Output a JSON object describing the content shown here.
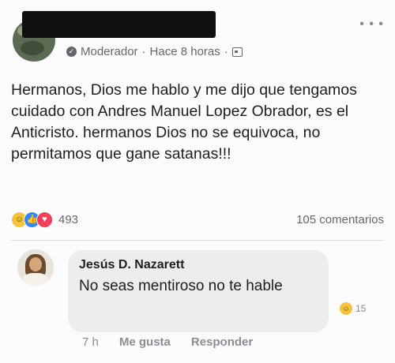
{
  "post": {
    "more_icon": "more-horizontal-icon",
    "meta": {
      "badge_icon": "moderator-badge-icon",
      "role": "Moderador",
      "separator1": "·",
      "time": "Hace 8 horas",
      "separator2": "·",
      "audience_icon": "group-audience-icon"
    },
    "text": "Hermanos, Dios me hablo y me dijo que tengamos cuidado con Andres Manuel Lopez Obrador, es el Anticristo. hermanos Dios no se equivoca, no permitamos que gane satanas!!!",
    "reactions": {
      "icons": [
        "haha-icon",
        "like-icon",
        "love-icon"
      ],
      "count": "493"
    },
    "comments_count": "105 comentarios"
  },
  "comment": {
    "author": "Jesús D. Nazarett",
    "text": "No seas mentiroso no te hable",
    "reaction_icon": "haha-icon",
    "reaction_count": "15",
    "actions": {
      "time": "7 h",
      "like": "Me gusta",
      "reply": "Responder"
    }
  }
}
